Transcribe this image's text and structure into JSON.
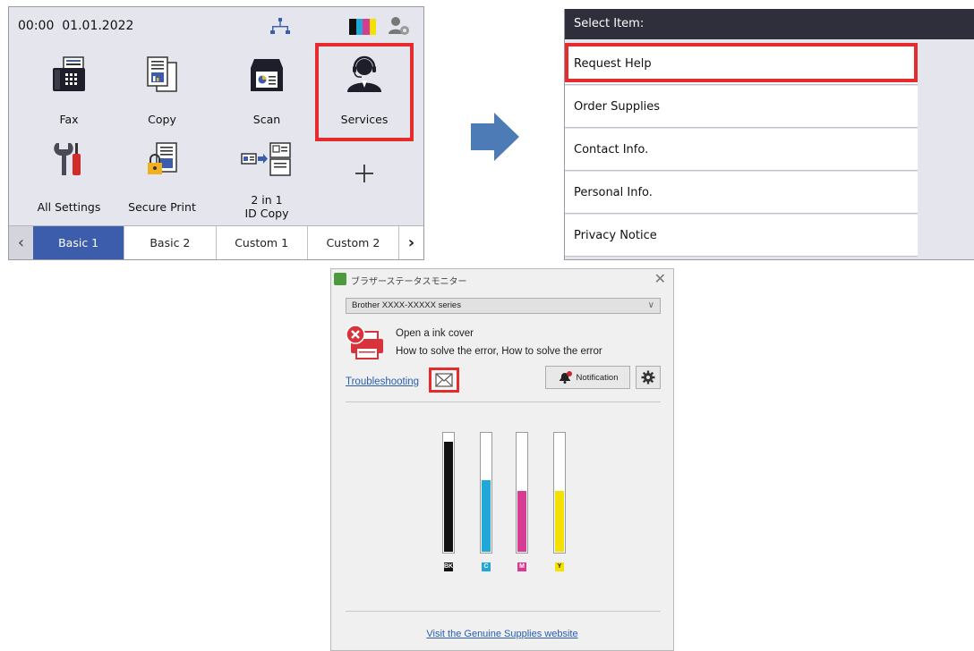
{
  "lcd": {
    "time": "00:00",
    "date": "01.01.2022",
    "tiles": [
      {
        "label": "Fax",
        "icon": "fax-icon"
      },
      {
        "label": "Copy",
        "icon": "copy-icon"
      },
      {
        "label": "Scan",
        "icon": "scan-icon"
      },
      {
        "label": "Services",
        "icon": "headset-support-icon"
      },
      {
        "label": "All Settings",
        "icon": "settings-tools-icon"
      },
      {
        "label": "Secure Print",
        "icon": "secure-print-icon"
      },
      {
        "label": "2 in 1\nID Copy",
        "icon": "id-copy-icon"
      },
      {
        "label": "",
        "icon": "plus-icon"
      }
    ],
    "tabs": [
      "Basic 1",
      "Basic 2",
      "Custom 1",
      "Custom 2"
    ],
    "active_tab": "Basic 1",
    "ink_colors": [
      "#111111",
      "#21a7d8",
      "#d63c91",
      "#f5e100"
    ]
  },
  "select_panel": {
    "header": "Select Item:",
    "items": [
      "Request Help",
      "Order Supplies",
      "Contact Info.",
      "Personal Info.",
      "Privacy Notice"
    ],
    "highlighted": "Request Help"
  },
  "monitor": {
    "window_title": "ブラザーステータスモニター",
    "device": "Brother XXXX-XXXXX series",
    "error_title": "Open a ink cover",
    "error_detail": "How to solve the error, How to solve the error",
    "troubleshooting": "Troubleshooting",
    "notification": "Notification",
    "ink_levels": [
      {
        "label": "BK",
        "color": "#111111",
        "level": 0.92
      },
      {
        "label": "C",
        "color": "#21a7d8",
        "level": 0.6
      },
      {
        "label": "M",
        "color": "#d63c91",
        "level": 0.51
      },
      {
        "label": "Y",
        "color": "#f5e100",
        "level": 0.51
      }
    ],
    "genuine_link": "Visit the Genuine Supplies website"
  },
  "colors": {
    "highlight": "#e52b2b",
    "tab_active": "#3b5dab",
    "arrow": "#4c7bb6"
  }
}
